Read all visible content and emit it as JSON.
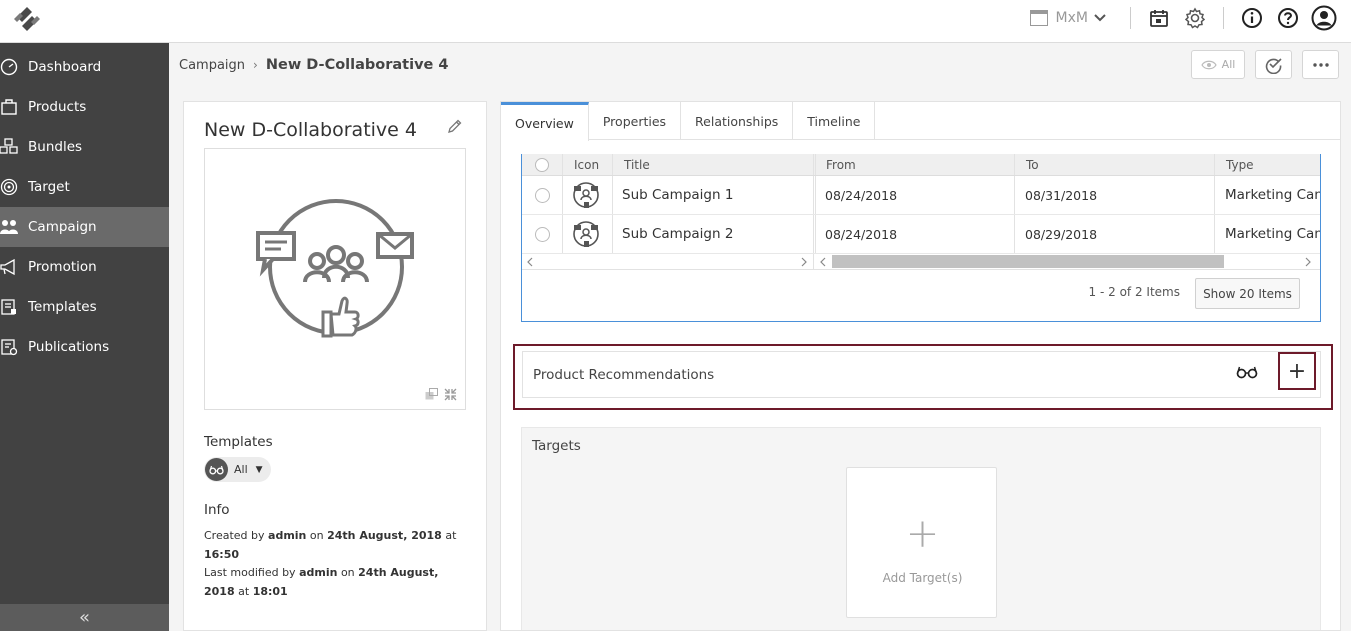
{
  "topbar": {
    "org_label": "MxM"
  },
  "sidebar": {
    "items": [
      {
        "label": "Dashboard",
        "icon": "dashboard-icon"
      },
      {
        "label": "Products",
        "icon": "products-icon"
      },
      {
        "label": "Bundles",
        "icon": "bundles-icon"
      },
      {
        "label": "Target",
        "icon": "target-icon"
      },
      {
        "label": "Campaign",
        "icon": "campaign-icon",
        "active": true
      },
      {
        "label": "Promotion",
        "icon": "megaphone-icon"
      },
      {
        "label": "Templates",
        "icon": "templates-icon"
      },
      {
        "label": "Publications",
        "icon": "publications-icon"
      }
    ],
    "collapse_glyph": "«"
  },
  "breadcrumb": {
    "root": "Campaign",
    "separator": "›",
    "current": "New D-Collaborative 4",
    "view_filter_label": "All"
  },
  "left_card": {
    "title": "New D-Collaborative 4",
    "templates_label": "Templates",
    "template_chip": "All",
    "info_label": "Info",
    "created_prefix": "Created by",
    "created_user": "admin",
    "created_on": "on",
    "created_date": "24th August, 2018",
    "created_at": "at",
    "created_time": "16:50",
    "modified_prefix": "Last modified by",
    "modified_user": "admin",
    "modified_on": "on",
    "modified_date_1": "24th August,",
    "modified_date_2": "2018",
    "modified_at": "at",
    "modified_time": "18:01"
  },
  "tabs": [
    {
      "label": "Overview",
      "active": true
    },
    {
      "label": "Properties"
    },
    {
      "label": "Relationships"
    },
    {
      "label": "Timeline"
    }
  ],
  "grid": {
    "columns": [
      "Icon",
      "Title",
      "From",
      "To",
      "Type"
    ],
    "rows": [
      {
        "title": "Sub Campaign 1",
        "from": "08/24/2018",
        "to": "08/31/2018",
        "type": "Marketing Can"
      },
      {
        "title": "Sub Campaign 2",
        "from": "08/24/2018",
        "to": "08/29/2018",
        "type": "Marketing Can"
      }
    ],
    "pager_info": "1 - 2 of 2 Items",
    "show_button": "Show 20 Items"
  },
  "product_recommendations": {
    "title": "Product Recommendations",
    "add_glyph": "+"
  },
  "targets": {
    "title": "Targets",
    "add_glyph": "+",
    "add_label": "Add Target(s)"
  },
  "colors": {
    "sidebar_bg": "#424242",
    "sidebar_active": "#6a6a6a",
    "accent_blue": "#4a90d9",
    "highlight_border": "#6d1a2a"
  }
}
